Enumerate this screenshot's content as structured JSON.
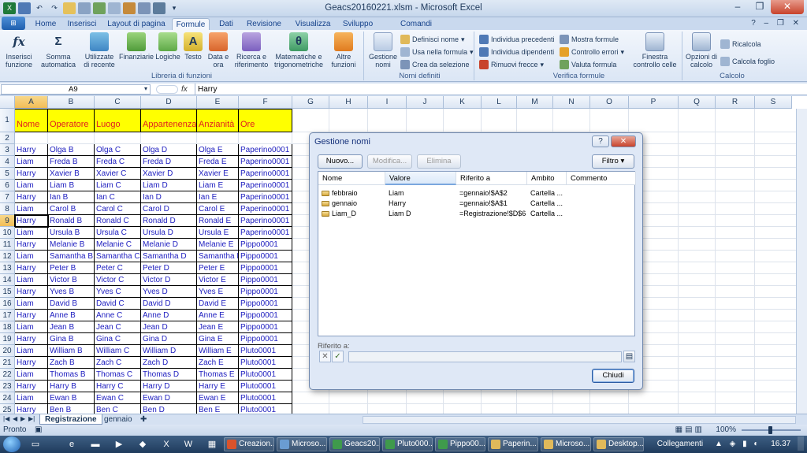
{
  "window": {
    "title": "Geacs20160221.xlsm - Microsoft Excel",
    "minimize": "–",
    "maximize": "❐",
    "close": "✕"
  },
  "ribbon_tabs": [
    "Home",
    "Inserisci",
    "Layout di pagina",
    "Formule",
    "Dati",
    "Revisione",
    "Visualizza",
    "Sviluppo",
    "Comandi Personali"
  ],
  "active_tab": "Formule",
  "ribbon": {
    "library": {
      "label": "Libreria di funzioni",
      "insert_fn": "Inserisci funzione",
      "autosum": "Somma automatica",
      "recent": "Utilizzate di recente",
      "financial": "Finanziarie",
      "logical": "Logiche",
      "text": "Testo",
      "datetime": "Data e ora",
      "lookup": "Ricerca e riferimento",
      "math": "Matematiche e trigonometriche",
      "more": "Altre funzioni"
    },
    "names": {
      "label": "Nomi definiti",
      "manager": "Gestione nomi",
      "define": "Definisci nome",
      "use": "Usa nella formula",
      "create": "Crea da selezione"
    },
    "audit": {
      "label": "Verifica formule",
      "precedents": "Individua precedenti",
      "dependents": "Individua dipendenti",
      "remove": "Rimuovi frecce",
      "show": "Mostra formule",
      "errors": "Controllo errori",
      "evaluate": "Valuta formula",
      "watch": "Finestra controllo celle"
    },
    "calc": {
      "label": "Calcolo",
      "options": "Opzioni di calcolo",
      "now": "Ricalcola",
      "sheet": "Calcola foglio"
    }
  },
  "formula_bar": {
    "namebox": "A9",
    "fx": "fx",
    "value": "Harry"
  },
  "columns": [
    "A",
    "B",
    "C",
    "D",
    "E",
    "F",
    "G",
    "H",
    "I",
    "J",
    "K",
    "L",
    "M",
    "N",
    "O",
    "P",
    "Q",
    "R",
    "S"
  ],
  "headers": [
    "Nome",
    "Operatore",
    "Luogo",
    "Appartenenza",
    "Anzianità",
    "Ore"
  ],
  "rows": [
    {
      "n": "1"
    },
    {
      "n": "2"
    },
    {
      "n": "3",
      "c": [
        "Harry",
        "Olga B",
        "Olga C",
        "Olga D",
        "Olga E",
        "Paperino0001"
      ]
    },
    {
      "n": "4",
      "c": [
        "Liam",
        "Freda B",
        "Freda C",
        "Freda D",
        "Freda E",
        "Paperino0001"
      ]
    },
    {
      "n": "5",
      "c": [
        "Harry",
        "Xavier B",
        "Xavier C",
        "Xavier D",
        "Xavier E",
        "Paperino0001"
      ]
    },
    {
      "n": "6",
      "c": [
        "Liam",
        "Liam B",
        "Liam C",
        "Liam D",
        "Liam E",
        "Paperino0001"
      ]
    },
    {
      "n": "7",
      "c": [
        "Harry",
        "Ian B",
        "Ian C",
        "Ian D",
        "Ian E",
        "Paperino0001"
      ]
    },
    {
      "n": "8",
      "c": [
        "Liam",
        "Carol B",
        "Carol C",
        "Carol D",
        "Carol E",
        "Paperino0001"
      ]
    },
    {
      "n": "9",
      "c": [
        "Harry",
        "Ronald B",
        "Ronald C",
        "Ronald D",
        "Ronald E",
        "Paperino0001"
      ]
    },
    {
      "n": "10",
      "c": [
        "Liam",
        "Ursula B",
        "Ursula C",
        "Ursula D",
        "Ursula E",
        "Paperino0001"
      ]
    },
    {
      "n": "11",
      "c": [
        "Harry",
        "Melanie B",
        "Melanie C",
        "Melanie D",
        "Melanie E",
        "Pippo0001"
      ]
    },
    {
      "n": "12",
      "c": [
        "Liam",
        "Samantha B",
        "Samantha C",
        "Samantha D",
        "Samantha E",
        "Pippo0001"
      ]
    },
    {
      "n": "13",
      "c": [
        "Harry",
        "Peter B",
        "Peter C",
        "Peter D",
        "Peter E",
        "Pippo0001"
      ]
    },
    {
      "n": "14",
      "c": [
        "Liam",
        "Victor B",
        "Victor C",
        "Victor D",
        "Victor E",
        "Pippo0001"
      ]
    },
    {
      "n": "15",
      "c": [
        "Harry",
        "Yves B",
        "Yves C",
        "Yves D",
        "Yves E",
        "Pippo0001"
      ]
    },
    {
      "n": "16",
      "c": [
        "Liam",
        "David B",
        "David C",
        "David D",
        "David E",
        "Pippo0001"
      ]
    },
    {
      "n": "17",
      "c": [
        "Harry",
        "Anne B",
        "Anne C",
        "Anne D",
        "Anne E",
        "Pippo0001"
      ]
    },
    {
      "n": "18",
      "c": [
        "Liam",
        "Jean B",
        "Jean C",
        "Jean D",
        "Jean E",
        "Pippo0001"
      ]
    },
    {
      "n": "19",
      "c": [
        "Harry",
        "Gina B",
        "Gina C",
        "Gina D",
        "Gina E",
        "Pippo0001"
      ]
    },
    {
      "n": "20",
      "c": [
        "Liam",
        "William B",
        "William C",
        "William D",
        "William E",
        "Pluto0001"
      ]
    },
    {
      "n": "21",
      "c": [
        "Harry",
        "Zach B",
        "Zach C",
        "Zach D",
        "Zach E",
        "Pluto0001"
      ]
    },
    {
      "n": "22",
      "c": [
        "Liam",
        "Thomas B",
        "Thomas C",
        "Thomas D",
        "Thomas E",
        "Pluto0001"
      ]
    },
    {
      "n": "23",
      "c": [
        "Harry",
        "Harry B",
        "Harry C",
        "Harry D",
        "Harry E",
        "Pluto0001"
      ]
    },
    {
      "n": "24",
      "c": [
        "Liam",
        "Ewan B",
        "Ewan C",
        "Ewan D",
        "Ewan E",
        "Pluto0001"
      ]
    },
    {
      "n": "25",
      "c": [
        "Harry",
        "Ben B",
        "Ben C",
        "Ben D",
        "Ben E",
        "Pluto0001"
      ]
    }
  ],
  "selected_cell": "A9",
  "sheets": [
    "Registrazione",
    "gennaio"
  ],
  "active_sheet": "Registrazione",
  "status": {
    "ready": "Pronto",
    "zoom": "100%"
  },
  "dialog": {
    "title": "Gestione nomi",
    "help": "?",
    "close": "✕",
    "new": "Nuovo...",
    "edit": "Modifica...",
    "delete": "Elimina",
    "filter": "Filtro",
    "columns": [
      "Nome",
      "Valore",
      "Riferito a",
      "Ambito",
      "Commento"
    ],
    "names": [
      {
        "name": "febbraio",
        "value": "Liam",
        "ref": "=gennaio!$A$2",
        "scope": "Cartella ..."
      },
      {
        "name": "gennaio",
        "value": "Harry",
        "ref": "=gennaio!$A$1",
        "scope": "Cartella ..."
      },
      {
        "name": "Liam_D",
        "value": "Liam D",
        "ref": "=Registrazione!$D$6",
        "scope": "Cartella ..."
      }
    ],
    "refers_label": "Riferito a:",
    "cancel_glyph": "✕",
    "ok_glyph": "✓",
    "close_btn": "Chiudi"
  },
  "taskbar": {
    "items": [
      "Creazion...",
      "Microso...",
      "Geacs20...",
      "Pluto000...",
      "Pippo00...",
      "Paperin...",
      "Microso...",
      "Desktop..."
    ],
    "links": "Collegamenti",
    "clock": "16.37"
  },
  "colors": {
    "header_fill": "#ffff00",
    "header_text": "#e02020",
    "cell_text": "#2020c0"
  }
}
